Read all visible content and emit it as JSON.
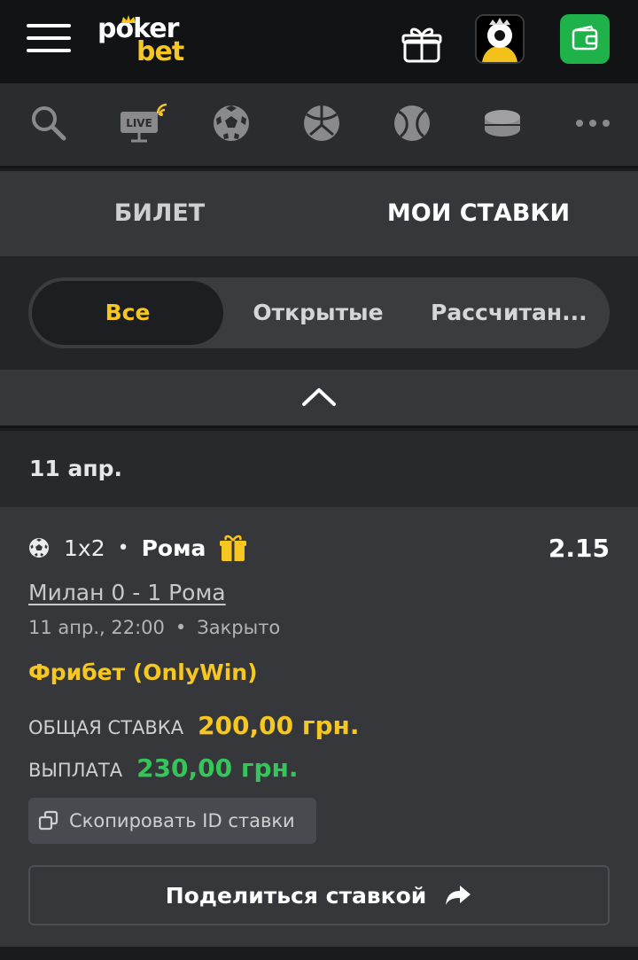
{
  "header": {
    "logo_top": "poker",
    "logo_bottom": "bet",
    "menu_icon": "hamburger-menu-icon",
    "gift_icon": "gift-icon",
    "wallet_icon": "wallet-icon",
    "colors": {
      "brand_yellow": "#f6c621",
      "wallet_green": "#1fb24a"
    }
  },
  "sports": {
    "live_label": "LIVE",
    "items": [
      "search-icon",
      "live-tv-icon",
      "soccer-ball-icon",
      "basketball-icon",
      "tennis-ball-icon",
      "hockey-puck-icon",
      "more-icon"
    ]
  },
  "tabs": {
    "ticket": "БИЛЕТ",
    "my_bets": "МОИ СТАВКИ",
    "active": "my_bets"
  },
  "filter": {
    "all": "Все",
    "open": "Открытые",
    "settled": "Рассчитан...",
    "active": "all"
  },
  "date_group": "11 апр.",
  "bet": {
    "market": "1x2",
    "selection": "Рома",
    "odds": "2.15",
    "match": "Милан 0 - 1 Рома",
    "datetime": "11 апр., 22:00",
    "status": "Закрыто",
    "bonus": "Фрибет (OnlyWin)",
    "stake_label": "ОБЩАЯ СТАВКА",
    "stake_value": "200,00 грн.",
    "payout_label": "ВЫПЛАТА",
    "payout_value": "230,00 грн.",
    "copy_label": "Скопировать ID ставки",
    "share_label": "Поделиться ставкой",
    "colors": {
      "stake": "#f6c621",
      "payout": "#35c65a"
    }
  }
}
